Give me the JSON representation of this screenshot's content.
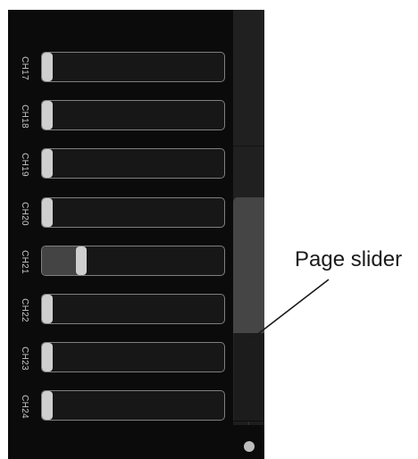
{
  "channels": [
    {
      "label": "CH17",
      "level": 0.0
    },
    {
      "label": "CH18",
      "level": 0.0
    },
    {
      "label": "CH19",
      "level": 0.0
    },
    {
      "label": "CH20",
      "level": 0.0
    },
    {
      "label": "CH21",
      "level": 0.2
    },
    {
      "label": "CH22",
      "level": 0.0
    },
    {
      "label": "CH23",
      "level": 0.0
    },
    {
      "label": "CH24",
      "level": 0.0
    }
  ],
  "page_slider": {
    "position": 0.67,
    "page_fraction": 0.33
  },
  "annotation": {
    "label": "Page slider"
  },
  "colors": {
    "screen_bg": "#0b0b0b",
    "track_border": "#7f7f7f",
    "thumb": "#cfcfcf",
    "fill": "#444444",
    "slider_thumb": "#454545",
    "callout": "#1a1a1a"
  }
}
